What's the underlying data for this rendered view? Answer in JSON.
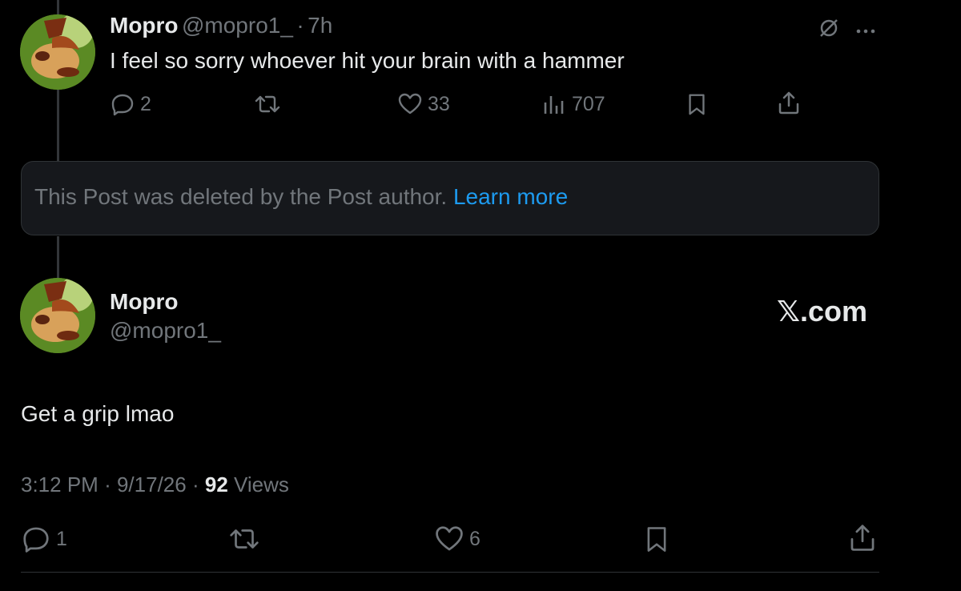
{
  "reply_post": {
    "author_name": "Mopro",
    "author_handle": "@mopro1_",
    "separator": "·",
    "time_ago": "7h",
    "text": "I feel so sorry whoever hit your brain with a hammer",
    "actions": {
      "replies": "2",
      "likes": "33",
      "views": "707"
    }
  },
  "deleted_notice": {
    "text": "This Post was deleted by the Post author.",
    "link": "Learn more"
  },
  "main_post": {
    "author_name": "Mopro",
    "author_handle": "@mopro1_",
    "watermark": "𝕏.com",
    "text": "Get a grip lmao",
    "time": "3:12 PM",
    "date": "9/17/26",
    "separator": "·",
    "views_count": "92",
    "views_label": "Views",
    "actions": {
      "replies": "1",
      "likes": "6"
    }
  },
  "colors": {
    "background": "#000000",
    "text_primary": "#e7e9ea",
    "text_secondary": "#71767b",
    "link": "#1d9bf0",
    "thread_line": "#333639"
  }
}
